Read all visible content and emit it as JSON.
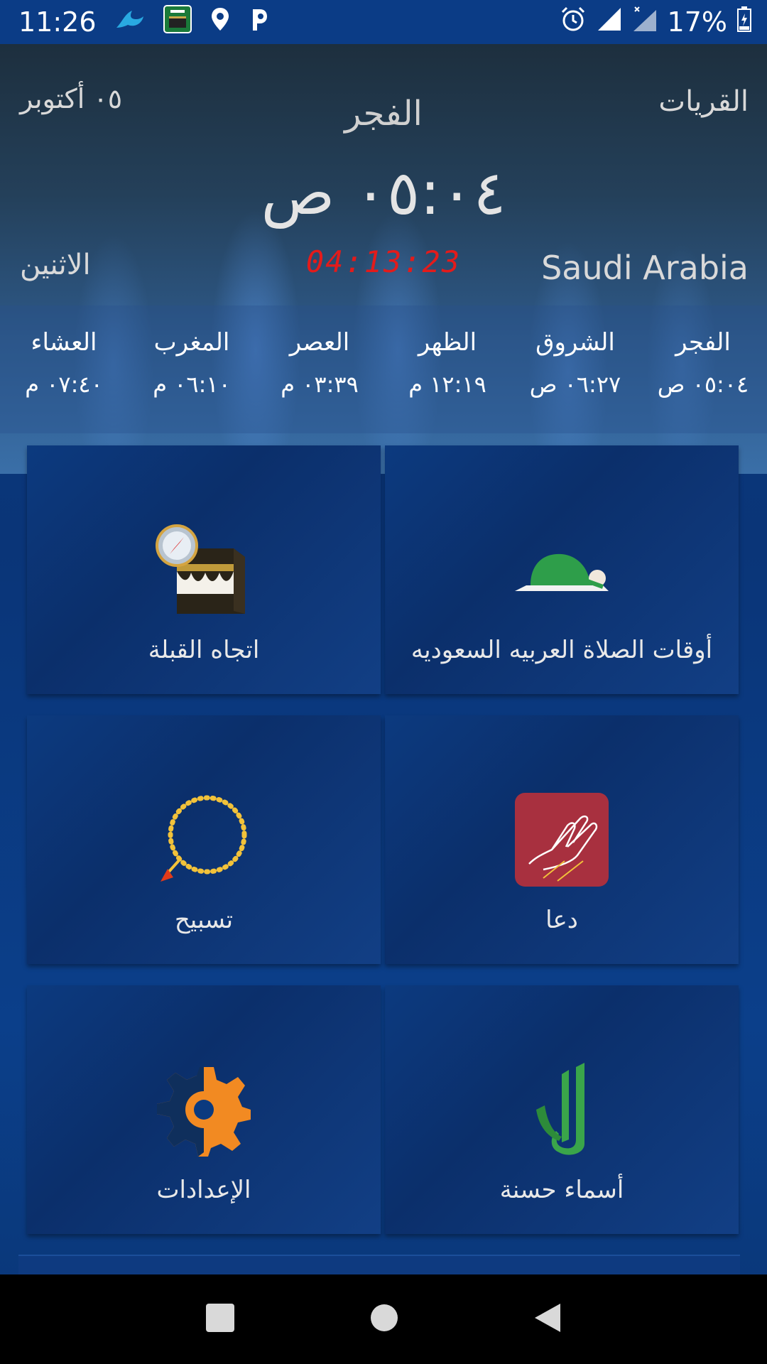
{
  "status_bar": {
    "time": "11:26",
    "battery": "17%",
    "icons": [
      "bird-icon",
      "saudi-flag-icon",
      "location-pin-icon",
      "p-icon",
      "alarm-icon",
      "signal-icon",
      "signal-x-icon",
      "battery-icon"
    ]
  },
  "header": {
    "city": "القريات",
    "date": "٠٥ أكتوبر",
    "next_prayer_name": "الفجر",
    "next_prayer_time": "٠٥:٠٤ ص",
    "day": "الاثنين",
    "countdown": "04:13:23",
    "country": "Saudi Arabia",
    "countdown_color": "#e31b1b"
  },
  "prayer_times": [
    {
      "name": "الفجر",
      "time": "٠٥:٠٤ ص"
    },
    {
      "name": "الشروق",
      "time": "٠٦:٢٧ ص"
    },
    {
      "name": "الظهر",
      "time": "١٢:١٩ م"
    },
    {
      "name": "العصر",
      "time": "٠٣:٣٩ م"
    },
    {
      "name": "المغرب",
      "time": "٠٦:١٠ م"
    },
    {
      "name": "العشاء",
      "time": "٠٧:٤٠ م"
    }
  ],
  "tiles": [
    {
      "label": "أوقات الصلاة العربيه السعوديه",
      "icon": "praying-person-icon"
    },
    {
      "label": "اتجاه القبلة",
      "icon": "kaaba-compass-icon"
    },
    {
      "label": "دعا",
      "icon": "praying-hands-icon"
    },
    {
      "label": "تسبيح",
      "icon": "prayer-beads-icon"
    },
    {
      "label": "أسماء حسنة",
      "icon": "allah-calligraphy-icon"
    },
    {
      "label": "الإعدادات",
      "icon": "gear-icon"
    }
  ],
  "nav": {
    "icons": [
      "recents-square-icon",
      "home-circle-icon",
      "back-triangle-icon"
    ]
  }
}
